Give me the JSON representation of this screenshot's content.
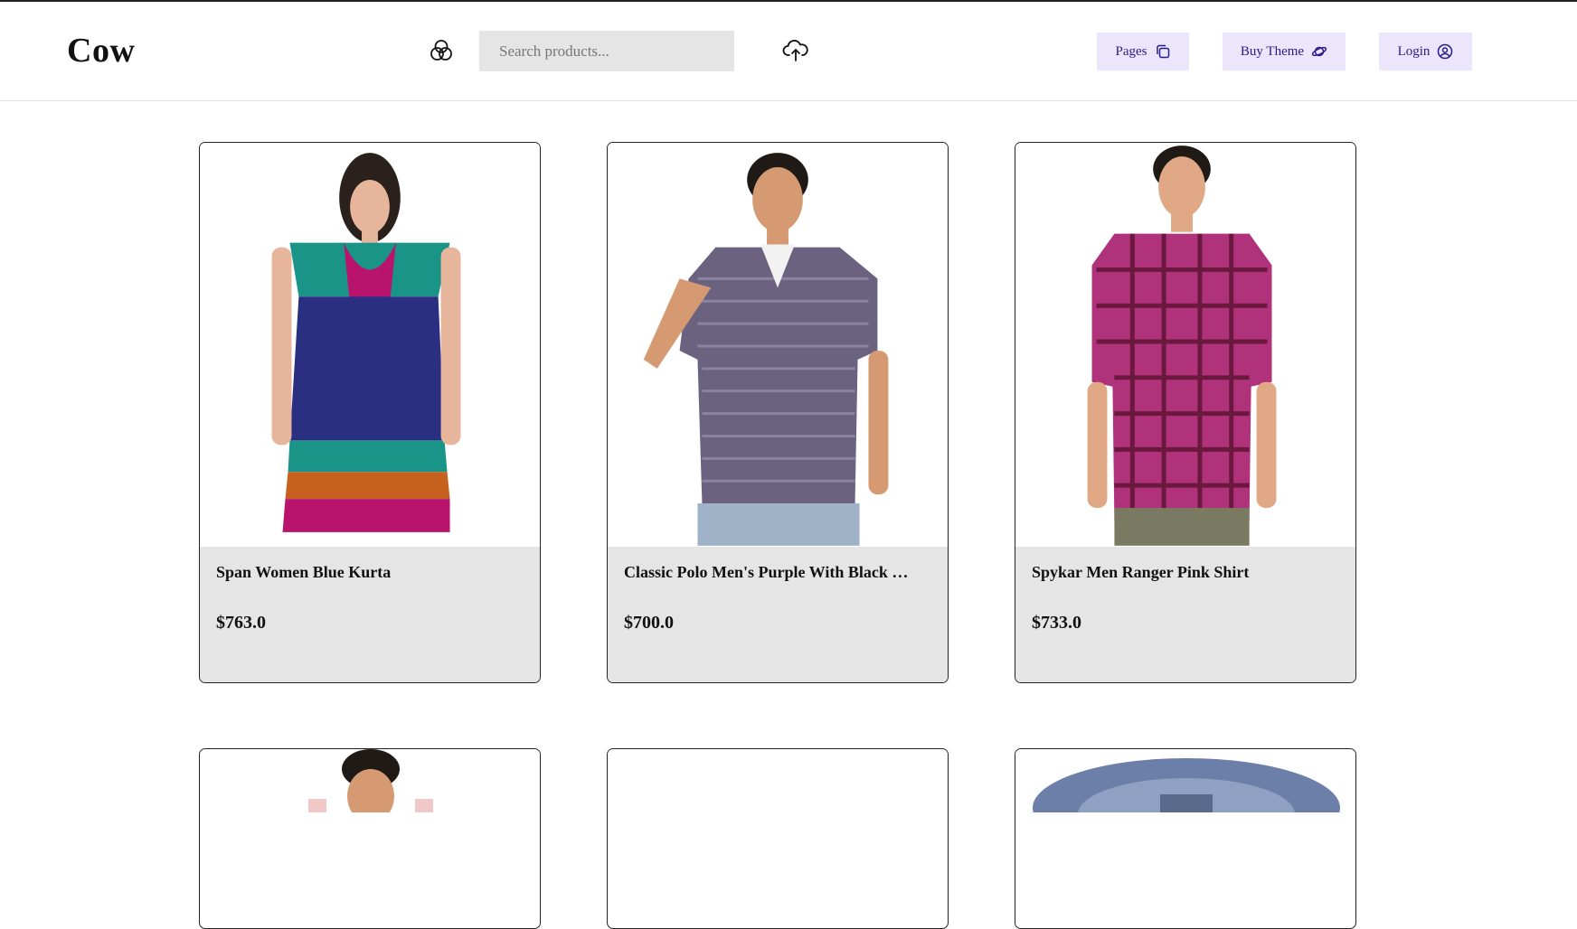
{
  "header": {
    "logo": "Cow",
    "search_placeholder": "Search products...",
    "nav": [
      {
        "label": "Pages",
        "icon": "copy-icon"
      },
      {
        "label": "Buy Theme",
        "icon": "planet-icon"
      },
      {
        "label": "Login",
        "icon": "user-circle-icon"
      }
    ]
  },
  "products": [
    {
      "name": "Span Women Blue Kurta",
      "price": "$763.0"
    },
    {
      "name": "Classic Polo Men's Purple With Black …",
      "price": "$700.0"
    },
    {
      "name": "Spykar Men Ranger Pink Shirt",
      "price": "$733.0"
    }
  ],
  "colors": {
    "nav_button_bg": "#ebe6fb",
    "nav_button_text": "#2a1a8c",
    "card_info_bg": "#e5e5e5",
    "search_bg": "#e5e5e5"
  }
}
